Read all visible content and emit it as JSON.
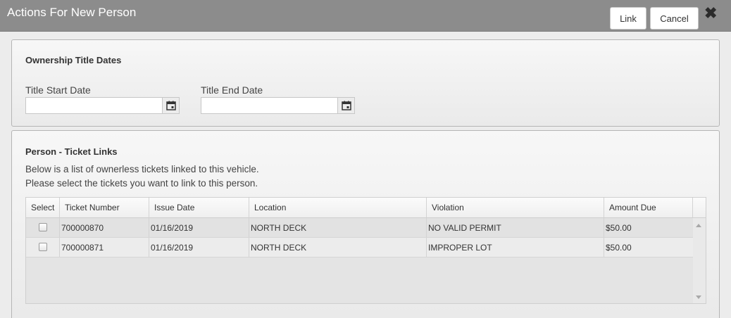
{
  "dialog": {
    "title": "Actions For New Person",
    "link_label": "Link",
    "cancel_label": "Cancel",
    "close_icon": "close-x-icon"
  },
  "ownership": {
    "heading": "Ownership Title Dates",
    "start_label": "Title Start Date",
    "start_value": "",
    "end_label": "Title End Date",
    "end_value": "",
    "calendar_icon": "calendar-icon"
  },
  "links": {
    "heading": "Person - Ticket Links",
    "desc1": "Below is a list of ownerless tickets linked to this vehicle.",
    "desc2": "Please select the tickets you want to link to this person.",
    "columns": [
      "Select",
      "Ticket Number",
      "Issue Date",
      "Location",
      "Violation",
      "Amount Due"
    ],
    "rows": [
      {
        "selected": false,
        "ticket": "700000870",
        "issue_date": "01/16/2019",
        "location": "NORTH DECK",
        "violation": "NO VALID PERMIT",
        "amount": "$50.00"
      },
      {
        "selected": false,
        "ticket": "700000871",
        "issue_date": "01/16/2019",
        "location": "NORTH DECK",
        "violation": "IMPROPER LOT",
        "amount": "$50.00"
      }
    ]
  }
}
